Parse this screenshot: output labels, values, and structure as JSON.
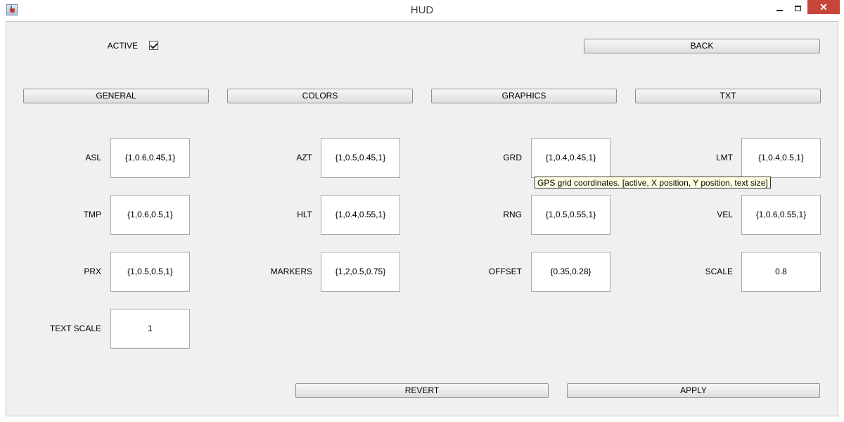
{
  "window": {
    "title": "HUD"
  },
  "active": {
    "label": "ACTIVE",
    "checked": true
  },
  "buttons": {
    "back": "BACK",
    "revert": "REVERT",
    "apply": "APPLY"
  },
  "tabs": [
    "GENERAL",
    "COLORS",
    "GRAPHICS",
    "TXT"
  ],
  "fields": [
    {
      "id": "asl",
      "label": "ASL",
      "value": "{1,0.6,0.45,1}"
    },
    {
      "id": "azt",
      "label": "AZT",
      "value": "{1,0.5,0.45,1}"
    },
    {
      "id": "grd",
      "label": "GRD",
      "value": "{1,0.4,0.45,1}"
    },
    {
      "id": "lmt",
      "label": "LMT",
      "value": "{1,0.4,0.5,1}"
    },
    {
      "id": "tmp",
      "label": "TMP",
      "value": "{1,0.6,0.5,1}"
    },
    {
      "id": "hlt",
      "label": "HLT",
      "value": "{1,0.4,0.55,1}"
    },
    {
      "id": "rng",
      "label": "RNG",
      "value": "{1,0.5,0.55,1}"
    },
    {
      "id": "vel",
      "label": "VEL",
      "value": "{1,0.6,0.55,1}"
    },
    {
      "id": "prx",
      "label": "PRX",
      "value": "{1,0.5,0.5,1}"
    },
    {
      "id": "markers",
      "label": "MARKERS",
      "value": "{1,2,0.5,0.75}"
    },
    {
      "id": "offset",
      "label": "OFFSET",
      "value": "{0.35,0.28}"
    },
    {
      "id": "scale",
      "label": "SCALE",
      "value": "0.8"
    },
    {
      "id": "text_scale",
      "label": "TEXT SCALE",
      "value": "1"
    }
  ],
  "tooltip": "GPS grid coordinates. [active, X position, Y position, text size]",
  "icons": {
    "app": "java-app-icon",
    "minimize": "minimize-icon",
    "maximize": "maximize-icon",
    "close": "close-icon"
  },
  "colors": {
    "window_bg": "#f0f0f0",
    "close_button": "#c7453a",
    "tooltip_bg": "#ffffe1"
  }
}
